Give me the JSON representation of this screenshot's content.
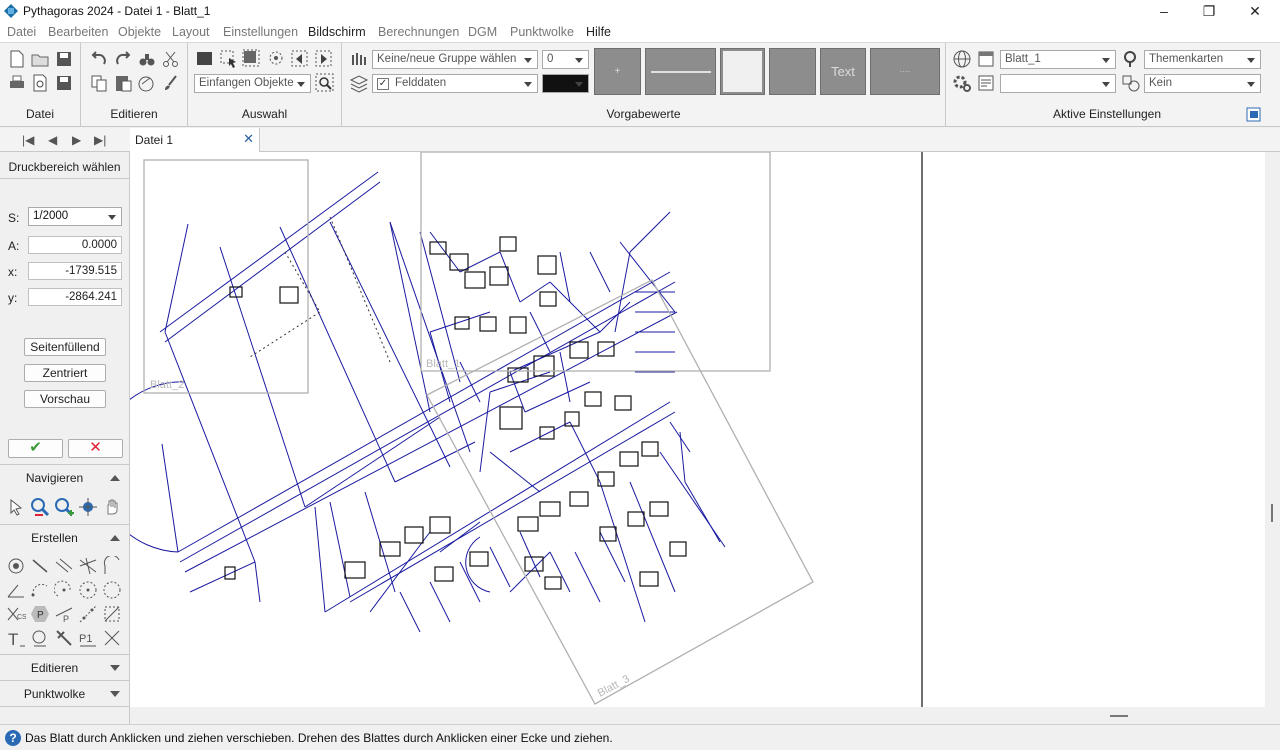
{
  "window": {
    "title": "Pythagoras 2024 - Datei 1 - Blatt_1",
    "minimize": "–",
    "maximize": "❐",
    "close": "✕"
  },
  "menu": [
    "Datei",
    "Bearbeiten",
    "Objekte",
    "Layout",
    "Einstellungen",
    "Bildschirm",
    "Berechnungen",
    "DGM",
    "Punktwolke",
    "Hilfe"
  ],
  "ribbon": {
    "groups": {
      "datei": "Datei",
      "editieren": "Editieren",
      "auswahl": "Auswahl",
      "vorgabewerte": "Vorgabewerte",
      "aktive": "Aktive Einstellungen"
    },
    "auswahl_combo": "Einfangen Objekte",
    "group_combo": "Keine/neue Gruppe wählen",
    "layer_combo": "Felddaten",
    "number_combo": "0",
    "swatch_text": "Text",
    "sheet_combo": "Blatt_1",
    "theme_combo": "Themenkarten",
    "blank_combo": "",
    "kein_combo": "Kein"
  },
  "doc_tab": {
    "label": "Datei 1",
    "close": "✕"
  },
  "left_nav": {
    "first": "|◀",
    "prev": "◀",
    "next": "▶",
    "last": "▶|"
  },
  "print_panel": {
    "title": "Druckbereich wählen",
    "s_label": "S:",
    "s_value": "1/2000",
    "a_label": "A:",
    "a_value": "0.0000",
    "x_label": "x:",
    "x_value": "-1739.515",
    "y_label": "y:",
    "y_value": "-2864.241",
    "btn_fill": "Seitenfüllend",
    "btn_center": "Zentriert",
    "btn_preview": "Vorschau",
    "ok": "✔",
    "cancel": "✕"
  },
  "sections": {
    "navigieren": "Navigieren",
    "erstellen": "Erstellen",
    "editieren": "Editieren",
    "punktwolke": "Punktwolke"
  },
  "sheets": {
    "blatt2": "Blatt_2",
    "blatt1": "Blatt_1",
    "blatt3": "Blatt_3"
  },
  "status": {
    "icon": "?",
    "text": "Das Blatt durch Anklicken und ziehen verschieben. Drehen des Blattes durch Anklicken einer Ecke und ziehen."
  },
  "colors": {
    "map_line": "#1a1aa0",
    "sheet_frame": "#b0b0b0",
    "accent": "#2a6ab5"
  }
}
